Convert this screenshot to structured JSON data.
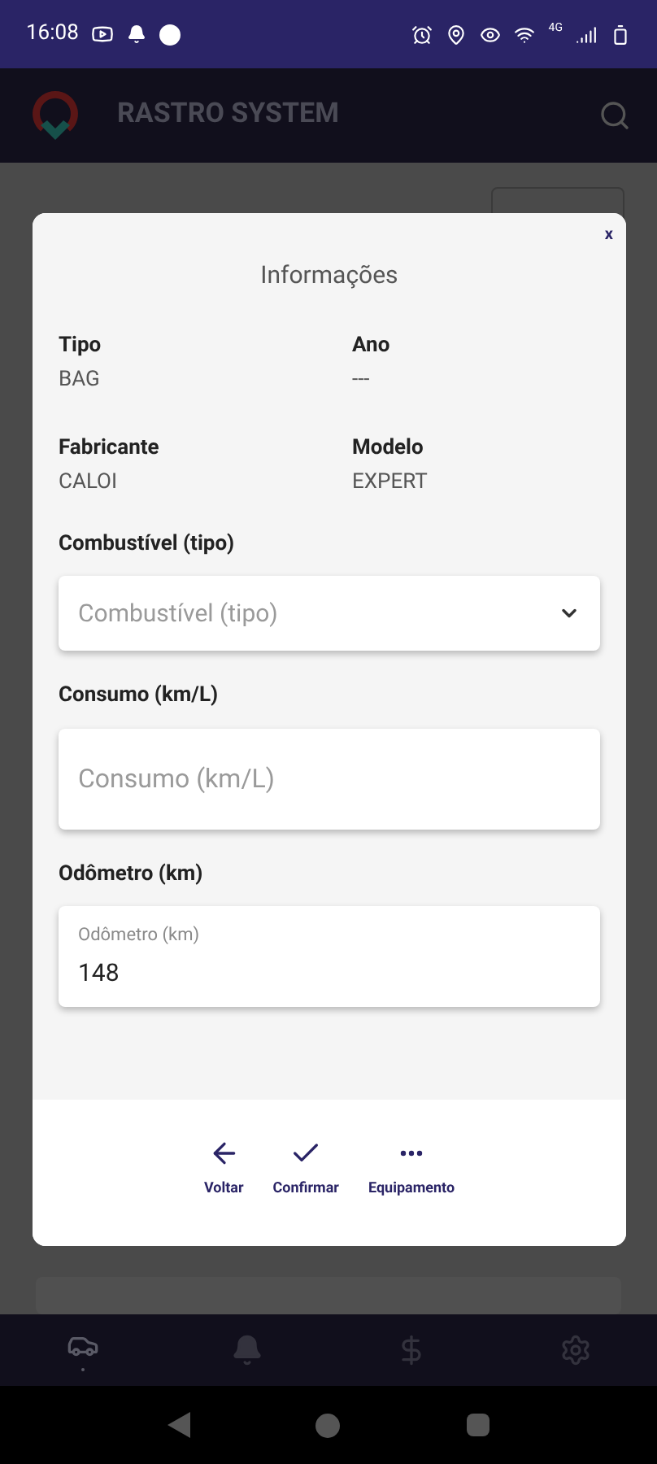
{
  "status_bar": {
    "time": "16:08",
    "network": "4G"
  },
  "app_bar": {
    "title": "RASTRO SYSTEM"
  },
  "dialog": {
    "title": "Informações",
    "close": "x",
    "details": [
      {
        "label": "Tipo",
        "value": "BAG"
      },
      {
        "label": "Ano",
        "value": "---"
      },
      {
        "label": "Fabricante",
        "value": "CALOI"
      },
      {
        "label": "Modelo",
        "value": "EXPERT"
      }
    ],
    "fields": [
      {
        "kind": "select",
        "label": "Combustível (tipo)",
        "placeholder": "Combustível (tipo)"
      },
      {
        "kind": "input",
        "label": "Consumo (km/L)",
        "placeholder": "Consumo (km/L)"
      },
      {
        "kind": "filled",
        "label": "Odômetro (km)",
        "floating_label": "Odômetro (km)",
        "value": "148"
      }
    ],
    "actions": [
      {
        "kind": "back",
        "label": "Voltar"
      },
      {
        "kind": "confirm",
        "label": "Confirmar"
      },
      {
        "kind": "more",
        "label": "Equipamento"
      }
    ]
  },
  "bottom_nav": [
    {
      "kind": "car",
      "selected": true
    },
    {
      "kind": "bell",
      "selected": false
    },
    {
      "kind": "dollar",
      "selected": false
    },
    {
      "kind": "gear",
      "selected": false
    }
  ]
}
